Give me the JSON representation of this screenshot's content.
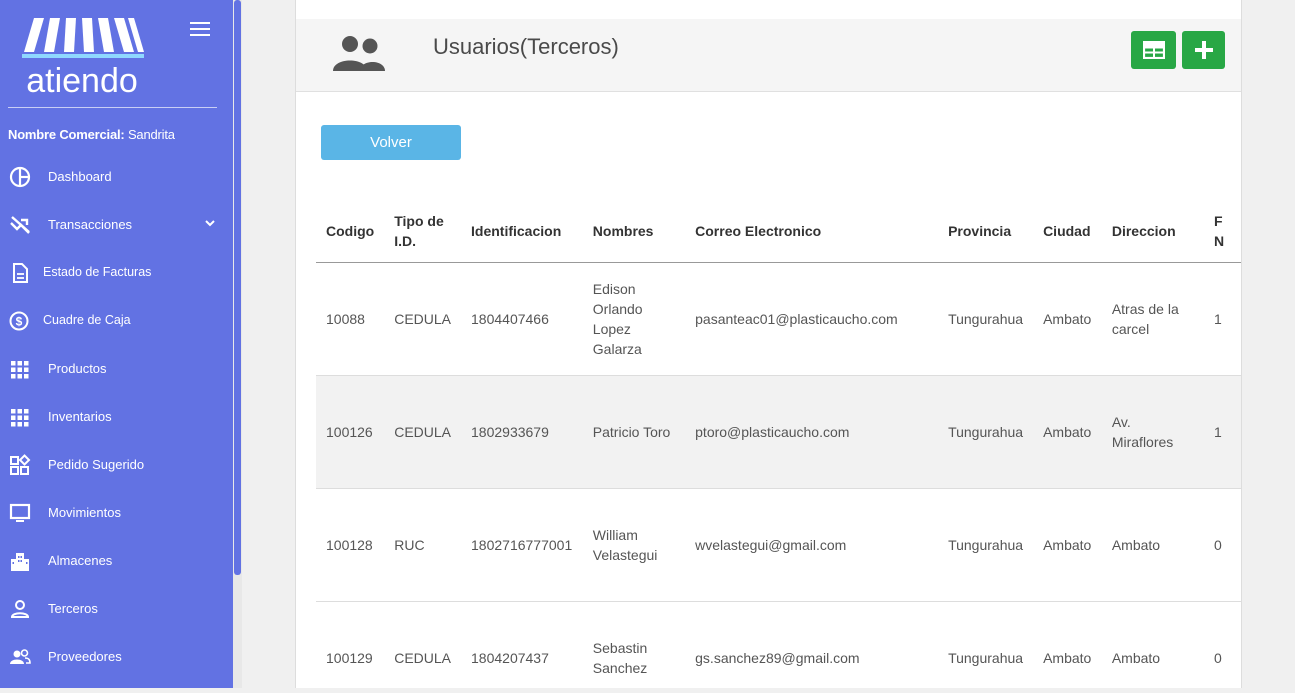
{
  "sidebar": {
    "brand_text": "atiendo",
    "commercial_label": "Nombre Comercial:",
    "commercial_name": "Sandrita",
    "items": [
      {
        "label": "Dashboard",
        "icon": "dashboard-icon"
      },
      {
        "label": "Transacciones",
        "icon": "transactions-icon",
        "expandable": true
      },
      {
        "label": "Estado de Facturas",
        "icon": "document-icon"
      },
      {
        "label": "Cuadre de Caja",
        "icon": "dollar-icon"
      },
      {
        "label": "Productos",
        "icon": "grid-icon"
      },
      {
        "label": "Inventarios",
        "icon": "grid-icon"
      },
      {
        "label": "Pedido Sugerido",
        "icon": "widgets-icon"
      },
      {
        "label": "Movimientos",
        "icon": "monitor-icon"
      },
      {
        "label": "Almacenes",
        "icon": "building-icon"
      },
      {
        "label": "Terceros",
        "icon": "person-icon"
      },
      {
        "label": "Proveedores",
        "icon": "people-icon"
      }
    ]
  },
  "header": {
    "title": "Usuarios(Terceros)"
  },
  "actions": {
    "back_label": "Volver"
  },
  "table": {
    "columns": [
      "Codigo",
      "Tipo de I.D.",
      "Identificacion",
      "Nombres",
      "Correo Electronico",
      "Provincia",
      "Ciudad",
      "Direccion",
      "F N"
    ],
    "rows": [
      {
        "codigo": "10088",
        "tipo": "CEDULA",
        "id": "1804407466",
        "nombres": "Edison Orlando Lopez Galarza",
        "correo": "pasanteac01@plasticaucho.com",
        "provincia": "Tungurahua",
        "ciudad": "Ambato",
        "direccion": "Atras de la carcel",
        "extra": "1"
      },
      {
        "codigo": "100126",
        "tipo": "CEDULA",
        "id": "1802933679",
        "nombres": "Patricio Toro",
        "correo": "ptoro@plasticaucho.com",
        "provincia": "Tungurahua",
        "ciudad": "Ambato",
        "direccion": "Av. Miraflores",
        "extra": "1"
      },
      {
        "codigo": "100128",
        "tipo": "RUC",
        "id": "1802716777001",
        "nombres": "William Velastegui",
        "correo": "wvelastegui@gmail.com",
        "provincia": "Tungurahua",
        "ciudad": "Ambato",
        "direccion": "Ambato",
        "extra": "0"
      },
      {
        "codigo": "100129",
        "tipo": "CEDULA",
        "id": "1804207437",
        "nombres": "Sebastin Sanchez",
        "correo": "gs.sanchez89@gmail.com",
        "provincia": "Tungurahua",
        "ciudad": "Ambato",
        "direccion": "Ambato",
        "extra": "0"
      }
    ]
  },
  "colors": {
    "sidebar": "#6272e3",
    "accent_green": "#28a745",
    "back_button": "#5ab5e6"
  }
}
